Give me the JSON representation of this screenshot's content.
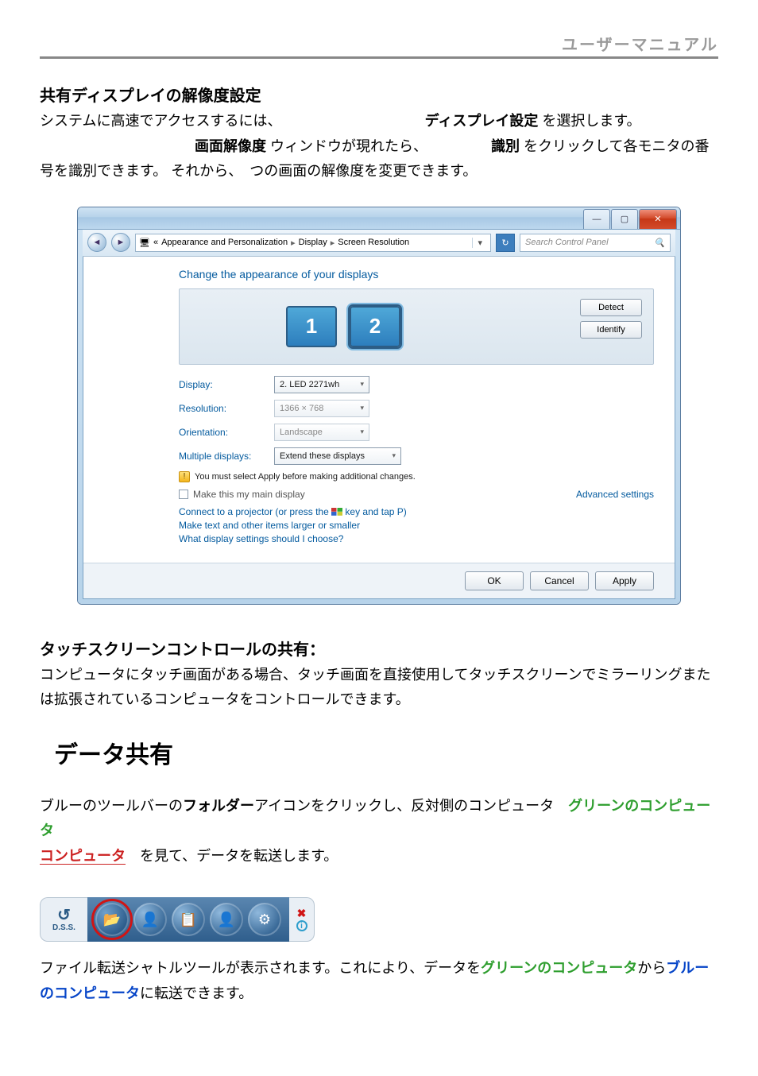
{
  "header": {
    "manual": "ユーザーマニュアル"
  },
  "sec1": {
    "title": "共有ディスプレイの解像度設定",
    "p1a": "システムに高速でアクセスするには、",
    "p1b": "ディスプレイ設定",
    "p1c": " を選択します。",
    "p2a": "画面解像度",
    "p2b": " ウィンドウが現れたら、",
    "p2c": "識別",
    "p2d": " をクリックして各モニタの番号を識別できます。 それから、　つの画面の解像度を変更できます。"
  },
  "win": {
    "title_btn_min": "—",
    "title_btn_max": "▢",
    "title_btn_close": "✕",
    "crumb1": "Appearance and Personalization",
    "crumb2": "Display",
    "crumb3": "Screen Resolution",
    "search_placeholder": "Search Control Panel",
    "heading": "Change the appearance of your displays",
    "mon1": "1",
    "mon2": "2",
    "btn_detect": "Detect",
    "btn_identify": "Identify",
    "label_display": "Display:",
    "val_display": "2. LED 2271wh",
    "label_resolution": "Resolution:",
    "val_resolution": "1366 × 768",
    "label_orientation": "Orientation:",
    "val_orientation": "Landscape",
    "label_multiple": "Multiple displays:",
    "val_multiple": "Extend these displays",
    "warn": "You must select Apply before making additional changes.",
    "chk_main": "Make this my main display",
    "adv": "Advanced settings",
    "link1a": "Connect to a projector (or press the ",
    "link1b": " key and tap P)",
    "link2": "Make text and other items larger or smaller",
    "link3": "What display settings should I choose?",
    "ok": "OK",
    "cancel": "Cancel",
    "apply": "Apply"
  },
  "sec2": {
    "title": "タッチスクリーンコントロールの共有：",
    "p": "コンピュータにタッチ画面がある場合、タッチ画面を直接使用してタッチスクリーンでミラーリングまたは拡張されているコンピュータをコントロールできます。"
  },
  "sec3": {
    "title": "データ共有",
    "p1a": "ブルーのツールバーの",
    "p1b": "フォルダー",
    "p1c": "アイコンをクリックし、反対側のコンピュータ　",
    "p1d": "グリーンのコンピュータ",
    "p1e": "　を見て、データを転送します。",
    "dss_label": "D.S.S.",
    "p2a": "ファイル転送シャトルツールが表示されます。これにより、データを",
    "p2b": "グリーンのコンピュータ",
    "p2c": "から",
    "p2d": "ブルーのコンピュータ",
    "p2e": "に転送できます。"
  }
}
